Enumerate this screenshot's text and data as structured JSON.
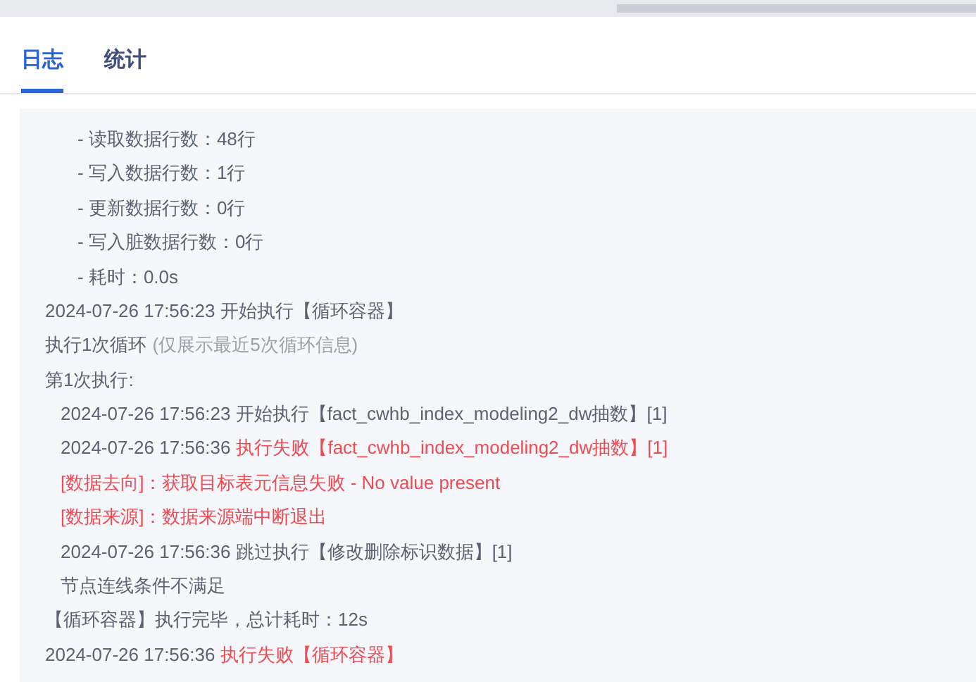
{
  "tabs": [
    {
      "label": "日志",
      "selected": true
    },
    {
      "label": "统计",
      "selected": false
    }
  ],
  "log": {
    "lines": [
      {
        "children": [
          {
            "children": [
              {
                "segments": [
                  {
                    "text": "- 读取数据行数：48行",
                    "color": "#5b6372"
                  }
                ]
              },
              {
                "segments": [
                  {
                    "text": "- 写入数据行数：1行",
                    "color": "#5b6372"
                  }
                ]
              },
              {
                "segments": [
                  {
                    "text": "- 更新数据行数：0行",
                    "color": "#5b6372"
                  }
                ]
              },
              {
                "segments": [
                  {
                    "text": "- 写入脏数据行数：0行",
                    "color": "#5b6372"
                  }
                ]
              },
              {
                "segments": [
                  {
                    "text": "- 耗时：0.0s",
                    "color": "#5b6372"
                  }
                ]
              }
            ]
          }
        ]
      },
      {
        "segments": [
          {
            "text": "2024-07-26 17:56:23 开始执行【循环容器】",
            "color": "#5b6372"
          }
        ]
      },
      {
        "segments": [
          {
            "text": "执行1次循环",
            "color": "#5b6372"
          },
          {
            "text": "(仅展示最近5次循环信息)",
            "color": "#9ba1ab"
          }
        ]
      },
      {
        "segments": [
          {
            "text": "第1次执行:",
            "color": "#5b6372"
          }
        ],
        "children": [
          {
            "segments": [
              {
                "text": "2024-07-26 17:56:23 开始执行【fact_cwhb_index_modeling2_dw抽数】[1]",
                "color": "#5b6372"
              }
            ]
          },
          {
            "segments": [
              {
                "text": "2024-07-26 17:56:36",
                "color": "#5b6372"
              },
              {
                "text": "执行失败【fact_cwhb_index_modeling2_dw抽数】[1]",
                "color": "#f04a52"
              }
            ]
          },
          {
            "segments": [
              {
                "text": "[数据去向]：获取目标表元信息失败 - No value present",
                "color": "#f04a52"
              }
            ]
          },
          {
            "segments": [
              {
                "text": "[数据来源]：数据来源端中断退出",
                "color": "#f04a52"
              }
            ]
          },
          {
            "segments": [
              {
                "text": "2024-07-26 17:56:36 跳过执行【修改删除标识数据】[1]",
                "color": "#5b6372"
              }
            ]
          },
          {
            "segments": [
              {
                "text": "节点连线条件不满足",
                "color": "#5b6372"
              }
            ]
          }
        ]
      },
      {
        "segments": [
          {
            "text": "【循环容器】执行完毕，总计耗时：12s",
            "color": "#5b6372"
          }
        ]
      },
      {
        "segments": [
          {
            "text": "2024-07-26 17:56:36",
            "color": "#5b6372"
          },
          {
            "text": "执行失败【循环容器】",
            "color": "#f04a52"
          }
        ]
      }
    ]
  }
}
